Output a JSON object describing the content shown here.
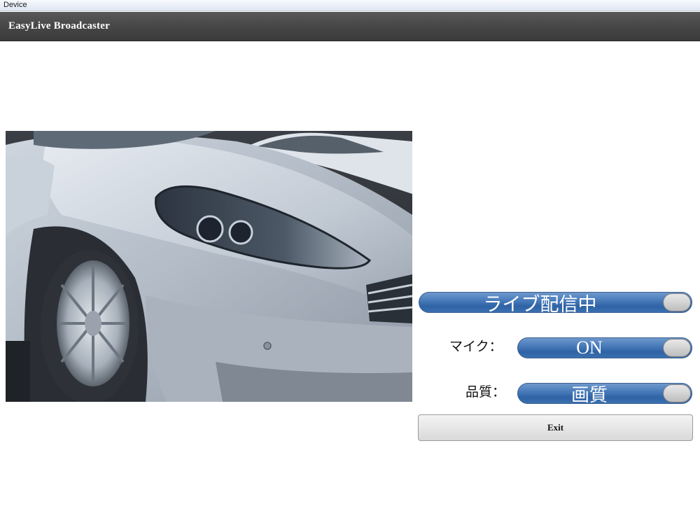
{
  "window": {
    "os_title": "Device"
  },
  "header": {
    "title": "EasyLive Broadcaster"
  },
  "preview": {
    "image_subject": "silver sports car front headlight photo"
  },
  "controls": {
    "live_toggle": {
      "label": "ライブ配信中"
    },
    "mic": {
      "label": "マイク：",
      "toggle_label": "ON"
    },
    "quality": {
      "label": "品質：",
      "toggle_label": "画質"
    },
    "exit_label": "Exit"
  },
  "colors": {
    "header_bg": "#474747",
    "toggle_blue": "#3b6fb0",
    "knob_gray": "#d4d4d4",
    "button_gray": "#e4e4e4"
  }
}
